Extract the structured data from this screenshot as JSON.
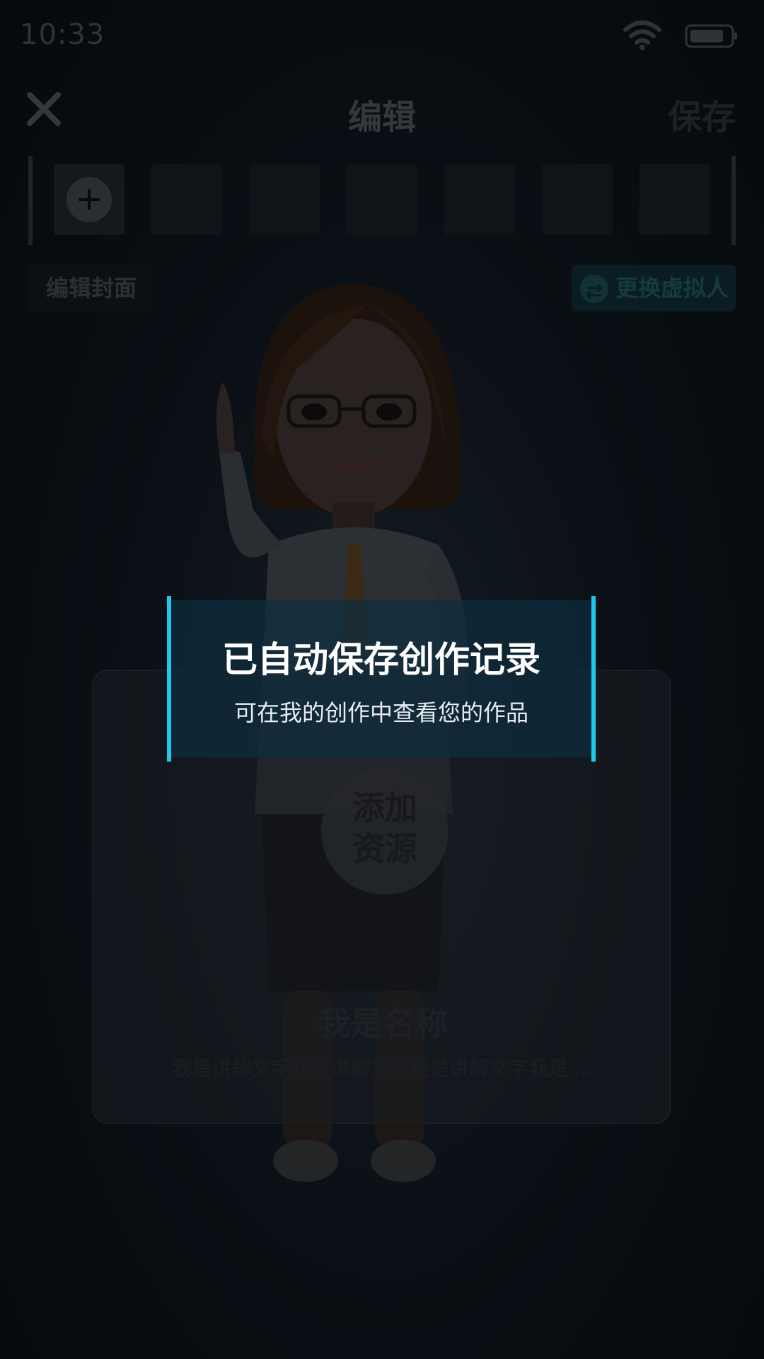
{
  "status_bar": {
    "time": "10:33",
    "wifi_icon": "wifi-icon",
    "battery_icon": "battery-icon"
  },
  "header": {
    "title": "编辑",
    "save_label": "保存",
    "close_icon": "close-icon"
  },
  "timeline": {
    "add_icon": "plus-icon",
    "thumbnail_count": 6
  },
  "toolbar": {
    "edit_cover_label": "编辑封面",
    "change_avatar_label": "更换虚拟人",
    "swap_icon": "swap-icon"
  },
  "card": {
    "add_resource_label_line1": "添加",
    "add_resource_label_line2": "资源",
    "name": "我是名称",
    "description": "我是讲解文字我是讲解文字我是讲解文字我是 ..."
  },
  "toast": {
    "title": "已自动保存创作记录",
    "subtitle": "可在我的创作中查看您的作品"
  },
  "colors": {
    "accent": "#1ec8ec",
    "toast_bg": "#0e2d3e"
  }
}
